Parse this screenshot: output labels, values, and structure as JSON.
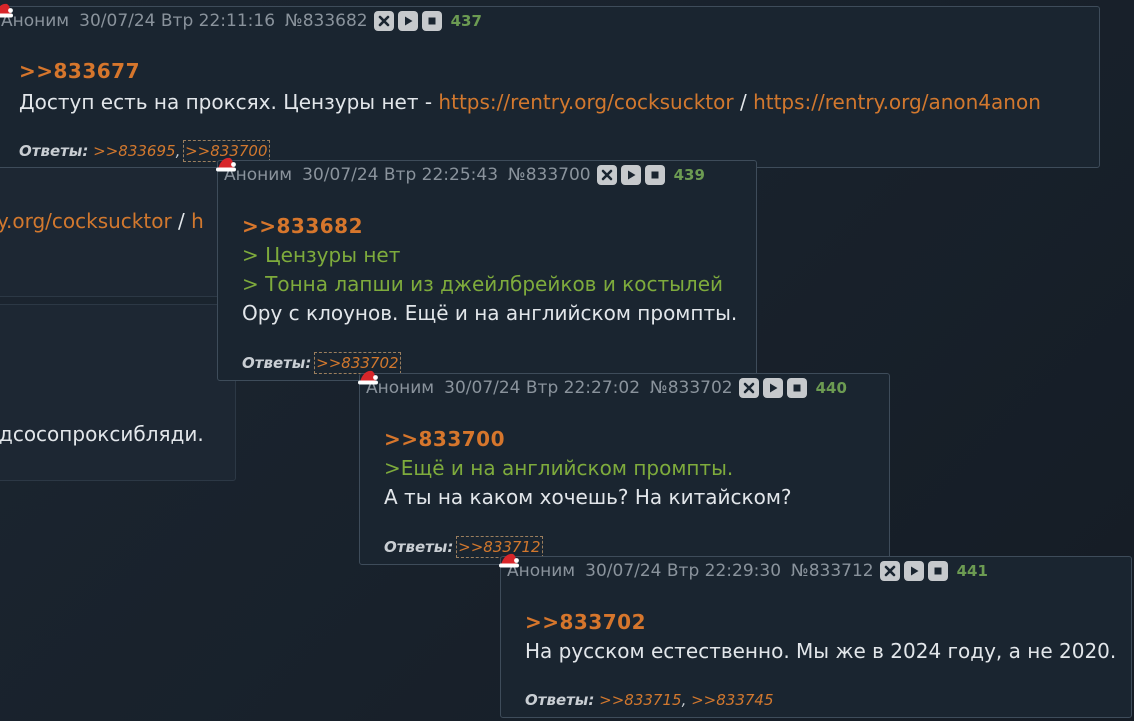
{
  "background": {
    "line1": {
      "link1": "y.org/cocksucktor",
      "sep": " / ",
      "link2": "h"
    },
    "line2": {
      "text": "дсосопроксибляди."
    }
  },
  "icons": {
    "hide": "close-x-icon",
    "play": "play-icon",
    "stop": "stop-square-icon",
    "hat": "santa-hat-icon"
  },
  "colors": {
    "background": "#18212b",
    "post_background": "#1a2530",
    "post_border": "#3e4c5a",
    "reply_link": "#d2782e",
    "quote_green": "#7eab3c",
    "post_counter": "#6c9b52",
    "header_text": "#8a939c",
    "body_text": "#e2e6ea"
  },
  "posts": [
    {
      "name": "Аноним",
      "date": "30/07/24 Втр 22:11:16",
      "number": "№833682",
      "count": "437",
      "ref": ">>833677",
      "text_before": "Доступ есть на проксях. Цензуры нет - ",
      "link1": "https://rentry.org/cocksucktor",
      "sep": " / ",
      "link2": "https://rentry.org/anon4anon",
      "answers_label": "Ответы:",
      "answers": [
        ">>833695",
        ">>833700"
      ]
    },
    {
      "name": "Аноним",
      "date": "30/07/24 Втр 22:25:43",
      "number": "№833700",
      "count": "439",
      "ref": ">>833682",
      "quote1": "> Цензуры нет",
      "quote2": "> Тонна лапши из джейлбрейков и костылей",
      "text": "Ору с клоунов. Ещё и на английском промпты.",
      "answers_label": "Ответы:",
      "answers": [
        ">>833702"
      ]
    },
    {
      "name": "Аноним",
      "date": "30/07/24 Втр 22:27:02",
      "number": "№833702",
      "count": "440",
      "ref": ">>833700",
      "quote1": ">Ещё и на английском промпты.",
      "text": "А ты на каком хочешь? На китайском?",
      "answers_label": "Ответы:",
      "answers": [
        ">>833712"
      ]
    },
    {
      "name": "Аноним",
      "date": "30/07/24 Втр 22:29:30",
      "number": "№833712",
      "count": "441",
      "ref": ">>833702",
      "text": "На русском естественно. Мы же в 2024 году, а не 2020.",
      "answers_label": "Ответы:",
      "answers": [
        ">>833715",
        ">>833745"
      ]
    }
  ]
}
